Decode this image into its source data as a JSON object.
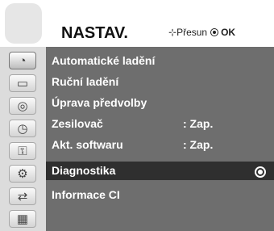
{
  "header": {
    "title": "NASTAV.",
    "nav_hint": "Přesun",
    "ok_label": "OK",
    "logo_icon": "setup-icon"
  },
  "sidebar": {
    "items": [
      {
        "icon": "setup-icon",
        "glyph": "◔"
      },
      {
        "icon": "picture-icon",
        "glyph": "▭"
      },
      {
        "icon": "audio-icon",
        "glyph": "◎"
      },
      {
        "icon": "time-icon",
        "glyph": "◷"
      },
      {
        "icon": "lock-icon",
        "glyph": "⚿"
      },
      {
        "icon": "option-icon",
        "glyph": "⚙"
      },
      {
        "icon": "input-icon",
        "glyph": "⇄"
      },
      {
        "icon": "usb-photo-icon",
        "glyph": "▦"
      }
    ]
  },
  "menu": {
    "items": [
      {
        "label": "Automatické ladění",
        "value": ""
      },
      {
        "label": "Ruční ladění",
        "value": ""
      },
      {
        "label": "Úprava předvolby",
        "value": ""
      },
      {
        "label": "Zesilovač",
        "value": ": Zap."
      },
      {
        "label": "Akt. softwaru",
        "value": ": Zap."
      },
      {
        "label": "Diagnostika",
        "value": ""
      },
      {
        "label": "Informace CI",
        "value": ""
      }
    ],
    "selected_index": 5
  },
  "colors": {
    "menu_bg": "#6e6e6e",
    "selected_bg": "#2f2f2f",
    "sidebar_bg": "#dcdcdc"
  }
}
